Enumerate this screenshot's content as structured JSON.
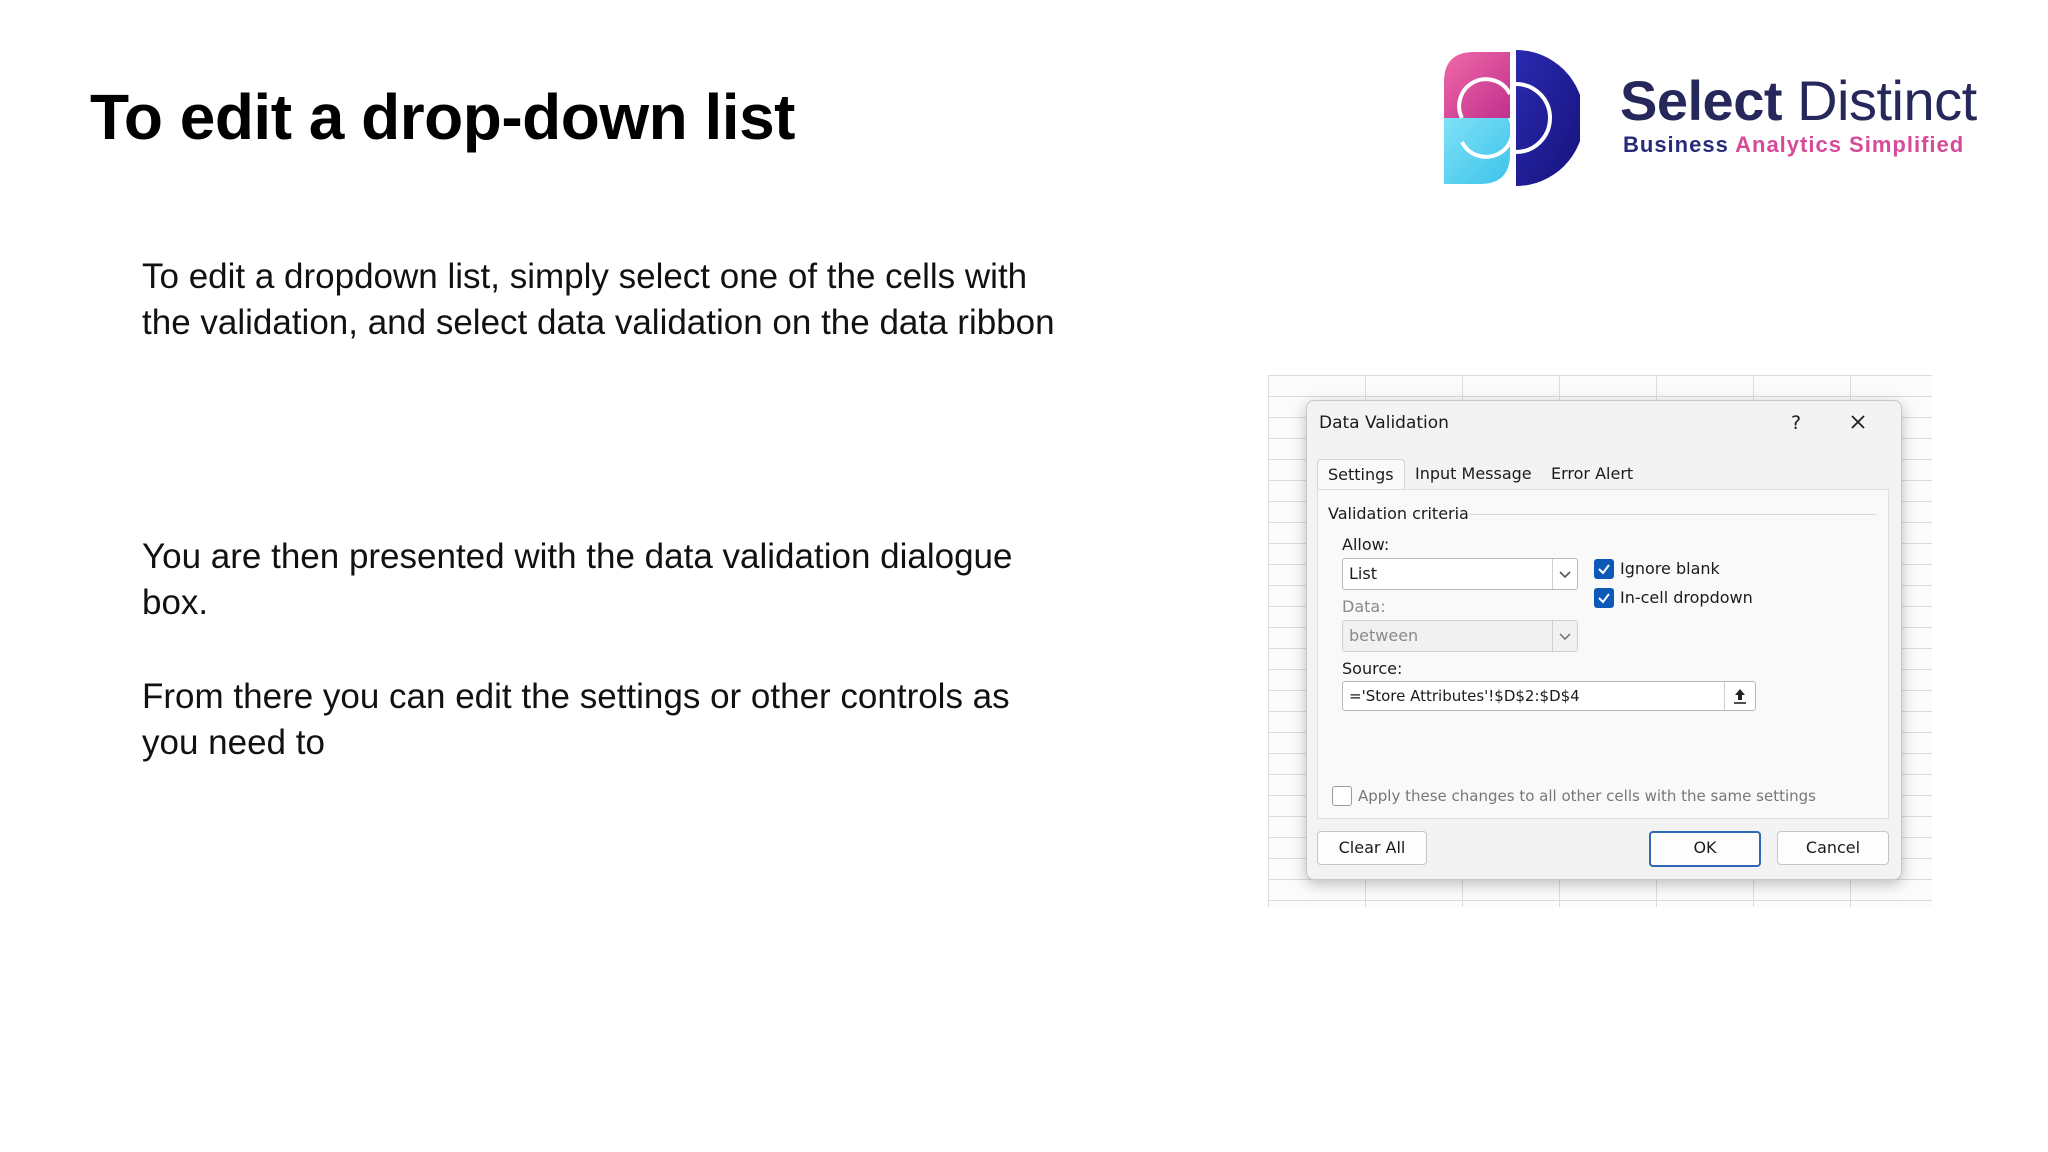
{
  "slide": {
    "title": "To edit a drop-down list",
    "paragraph1": "To edit a dropdown list, simply select one of the cells with the validation, and select data validation on the data ribbon",
    "paragraph2": "You are then presented with the data validation dialogue box.",
    "paragraph3": "From there you can edit the settings or other controls as you need to"
  },
  "brand": {
    "name_part1": "Select",
    "name_part2": "Distinct",
    "tagline_part1": "Business",
    "tagline_part2": "Analytics Simplified",
    "colors": {
      "navy": "#26275a",
      "pink": "#d64a9a",
      "cyan": "#5fd2f0",
      "blue": "#1e1b9a"
    }
  },
  "dialog": {
    "title": "Data Validation",
    "help_label": "?",
    "tabs": [
      {
        "label": "Settings",
        "active": true
      },
      {
        "label": "Input Message",
        "active": false
      },
      {
        "label": "Error Alert",
        "active": false
      }
    ],
    "group_label": "Validation criteria",
    "allow": {
      "label": "Allow:",
      "value": "List"
    },
    "data": {
      "label": "Data:",
      "value": "between",
      "disabled": true
    },
    "ignore_blank": {
      "label": "Ignore blank",
      "checked": true
    },
    "incell_dropdown": {
      "label": "In-cell dropdown",
      "checked": true
    },
    "source": {
      "label": "Source:",
      "value": "='Store Attributes'!$D$2:$D$4"
    },
    "apply_all": {
      "label": "Apply these changes to all other cells with the same settings",
      "checked": false
    },
    "buttons": {
      "clear_all": "Clear All",
      "ok": "OK",
      "cancel": "Cancel"
    },
    "accent_color": "#0c59b8"
  },
  "icons": {
    "close": "close-icon",
    "dropdown": "chevron-down-icon",
    "check": "checkmark-icon",
    "collapse": "collapse-dialog-icon",
    "logo": "select-distinct-logo-icon"
  }
}
